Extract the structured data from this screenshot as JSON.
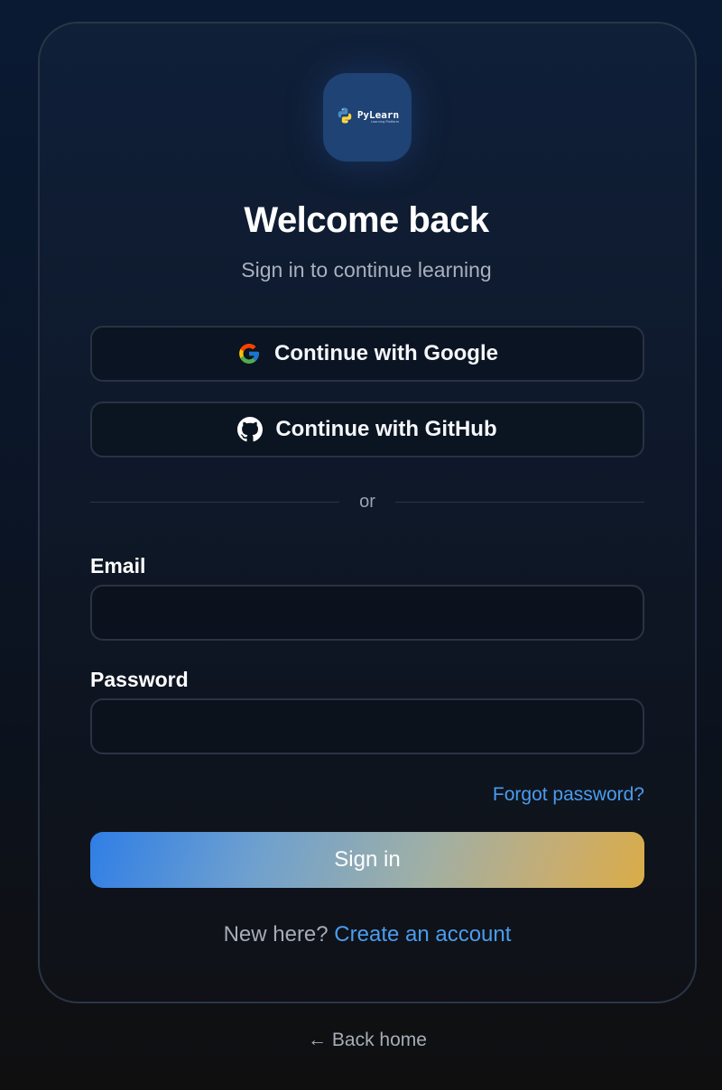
{
  "logo": {
    "name": "PyLearn",
    "tagline": "Learning Platform",
    "icon": "python-icon"
  },
  "header": {
    "title": "Welcome back",
    "subtitle": "Sign in to continue learning"
  },
  "oauth": {
    "google_label": "Continue with Google",
    "github_label": "Continue with GitHub"
  },
  "divider": {
    "text": "or"
  },
  "form": {
    "email_label": "Email",
    "email_value": "",
    "password_label": "Password",
    "password_value": "",
    "forgot_label": "Forgot password?",
    "submit_label": "Sign in"
  },
  "footer": {
    "signup_prompt": "New here?",
    "signup_link": "Create an account",
    "back_label": "← Back home"
  },
  "colors": {
    "accent_link": "#4a9cf0",
    "gradient_start": "#2f7ee6",
    "gradient_end": "#d9ac47"
  }
}
